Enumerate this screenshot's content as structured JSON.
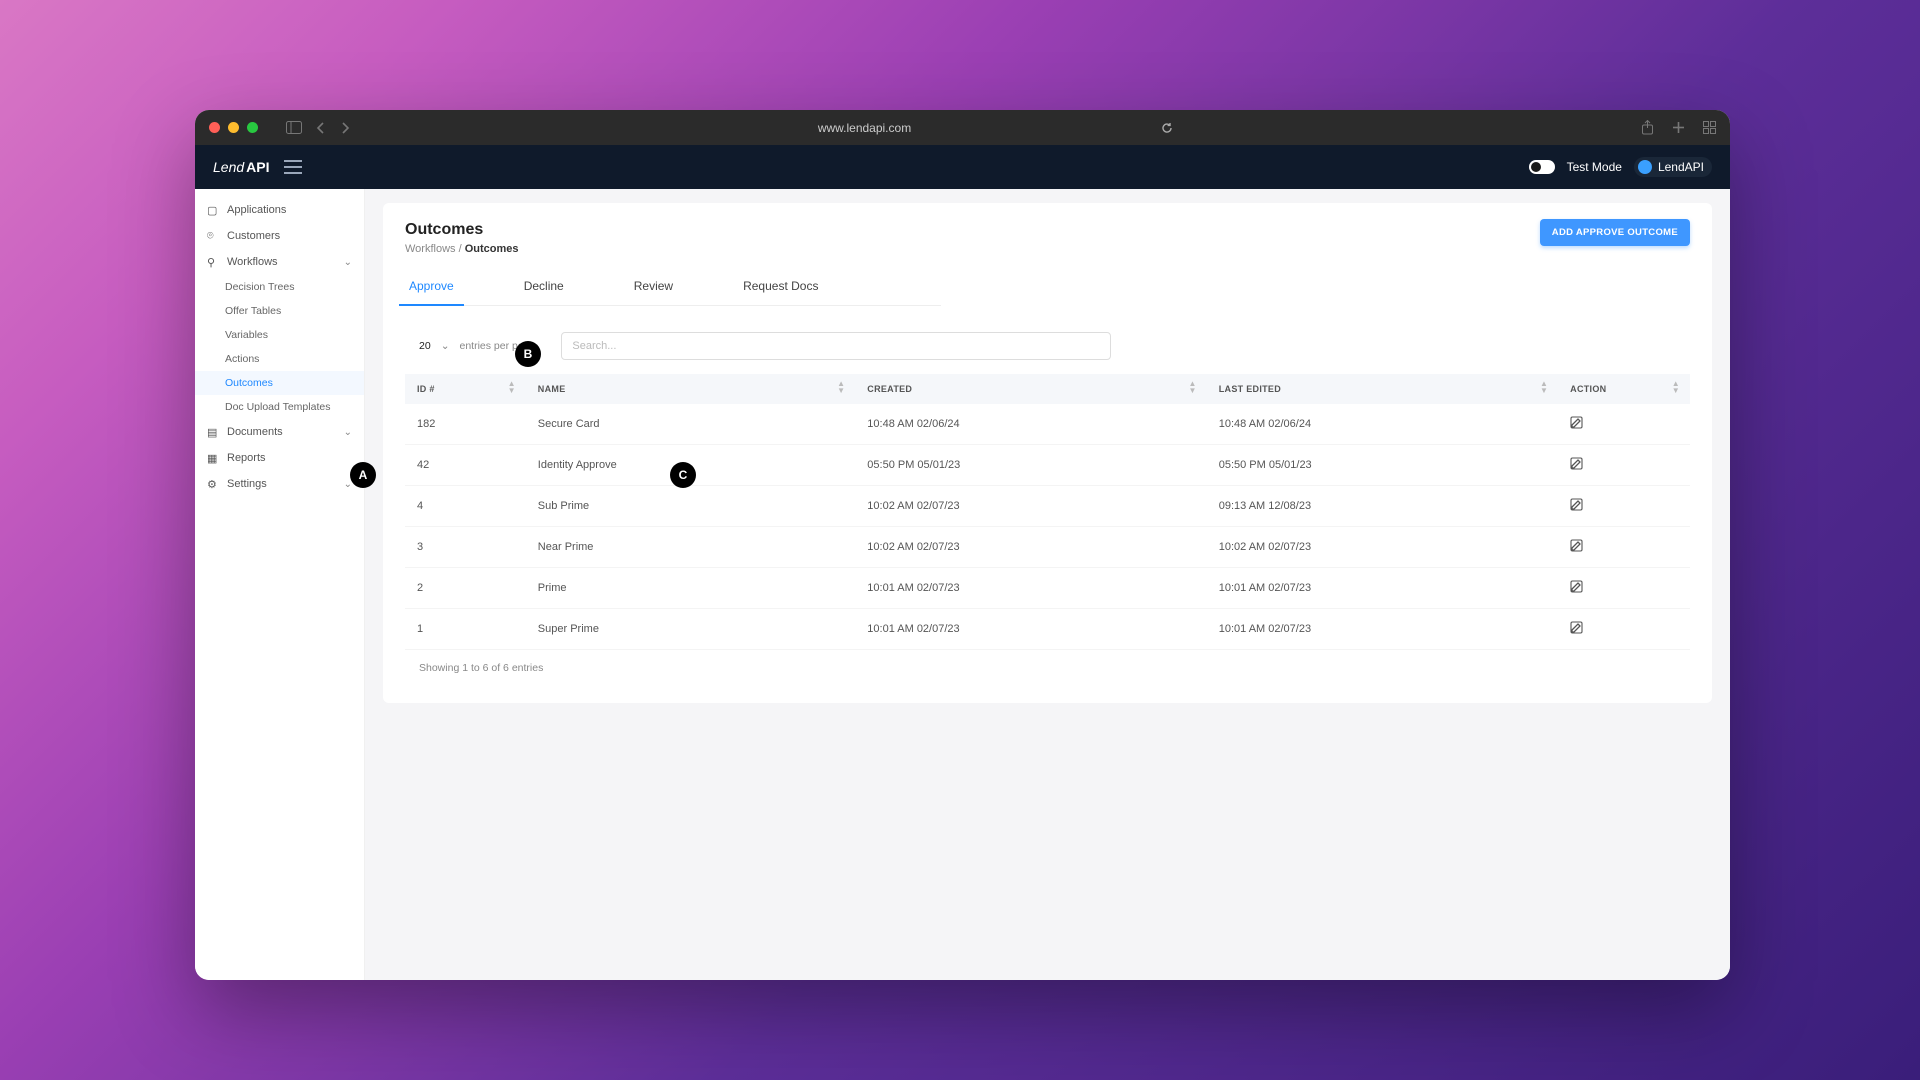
{
  "browser": {
    "url": "www.lendapi.com"
  },
  "header": {
    "brand_prefix": "Lend",
    "brand_bold": "API",
    "toggle_label": "Test Mode",
    "tenant_name": "LendAPI"
  },
  "sidebar": {
    "items": [
      {
        "label": "Applications",
        "children": null
      },
      {
        "label": "Customers",
        "children": null
      },
      {
        "label": "Workflows",
        "children": [
          {
            "label": "Decision Trees",
            "active": false
          },
          {
            "label": "Offer Tables",
            "active": false
          },
          {
            "label": "Variables",
            "active": false
          },
          {
            "label": "Actions",
            "active": false
          },
          {
            "label": "Outcomes",
            "active": true
          },
          {
            "label": "Doc Upload Templates",
            "active": false
          }
        ]
      },
      {
        "label": "Documents",
        "children": "collapsed"
      },
      {
        "label": "Reports",
        "children": null
      },
      {
        "label": "Settings",
        "children": "collapsed"
      }
    ]
  },
  "page": {
    "title": "Outcomes",
    "breadcrumb_root": "Workflows",
    "breadcrumb_sep": " / ",
    "breadcrumb_leaf": "Outcomes",
    "tabs": [
      "Approve",
      "Decline",
      "Review",
      "Request Docs"
    ],
    "active_tab_index": 0,
    "add_button": "ADD APPROVE OUTCOME",
    "entries_n": "20",
    "entries_label": "entries per page",
    "search_placeholder": "Search...",
    "columns": [
      "ID #",
      "NAME",
      "CREATED",
      "LAST EDITED",
      "ACTION"
    ],
    "rows": [
      {
        "id": "182",
        "name": "Secure Card",
        "created": "10:48 AM 02/06/24",
        "edited": "10:48 AM 02/06/24"
      },
      {
        "id": "42",
        "name": "Identity Approve",
        "created": "05:50 PM 05/01/23",
        "edited": "05:50 PM 05/01/23"
      },
      {
        "id": "4",
        "name": "Sub Prime",
        "created": "10:02 AM 02/07/23",
        "edited": "09:13 AM 12/08/23"
      },
      {
        "id": "3",
        "name": "Near Prime",
        "created": "10:02 AM 02/07/23",
        "edited": "10:02 AM 02/07/23"
      },
      {
        "id": "2",
        "name": "Prime",
        "created": "10:01 AM 02/07/23",
        "edited": "10:01 AM 02/07/23"
      },
      {
        "id": "1",
        "name": "Super Prime",
        "created": "10:01 AM 02/07/23",
        "edited": "10:01 AM 02/07/23"
      }
    ],
    "footer": "Showing 1 to 6 of 6 entries"
  },
  "annotations": {
    "A": "A",
    "B": "B",
    "C": "C"
  }
}
